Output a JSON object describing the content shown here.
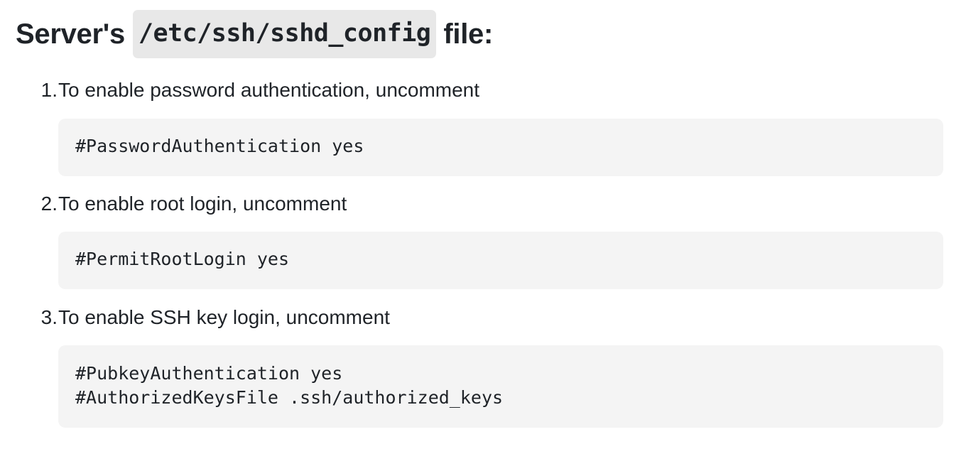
{
  "heading": {
    "prefix": "Server's",
    "code": "/etc/ssh/sshd_config",
    "suffix": "file:"
  },
  "steps": [
    {
      "number": "1.",
      "text": "To enable password authentication, uncomment",
      "code_lines": [
        "#PasswordAuthentication yes"
      ]
    },
    {
      "number": "2.",
      "text": "To enable root login, uncomment",
      "code_lines": [
        "#PermitRootLogin yes"
      ]
    },
    {
      "number": "3.",
      "text": "To enable SSH key login, uncomment",
      "code_lines": [
        "#PubkeyAuthentication yes",
        "#AuthorizedKeysFile .ssh/authorized_keys"
      ]
    }
  ]
}
